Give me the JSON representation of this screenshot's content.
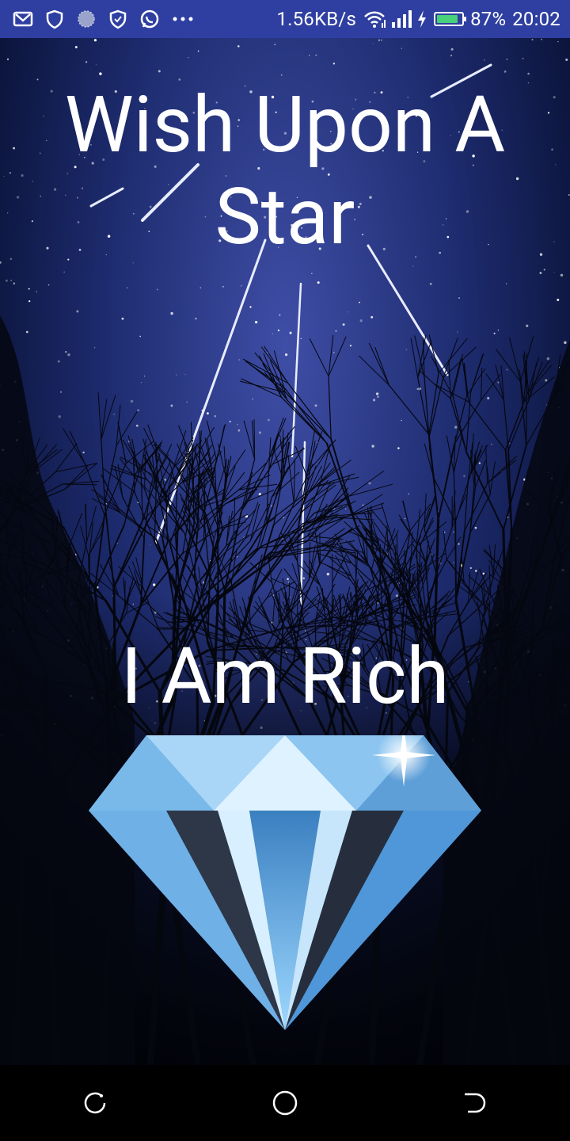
{
  "status_bar": {
    "network_speed": "1.56KB/s",
    "battery_percent": "87%",
    "battery_level": 0.87,
    "time": "20:02",
    "icons": [
      "gmail-icon",
      "shield-icon",
      "circle-dots-icon",
      "vpn-shield-icon",
      "whatsapp-icon",
      "more-dots-icon",
      "wifi-icon",
      "signal-icon",
      "charging-icon",
      "battery-icon"
    ],
    "colors": {
      "background": "#2f3fa1",
      "battery_fill": "#48d07a"
    }
  },
  "app": {
    "title_top": "Wish Upon A Star",
    "title_bottom": "I Am Rich",
    "image": "diamond-icon"
  },
  "nav_bar": {
    "buttons": [
      "recent-apps-button",
      "home-button",
      "back-button"
    ]
  }
}
